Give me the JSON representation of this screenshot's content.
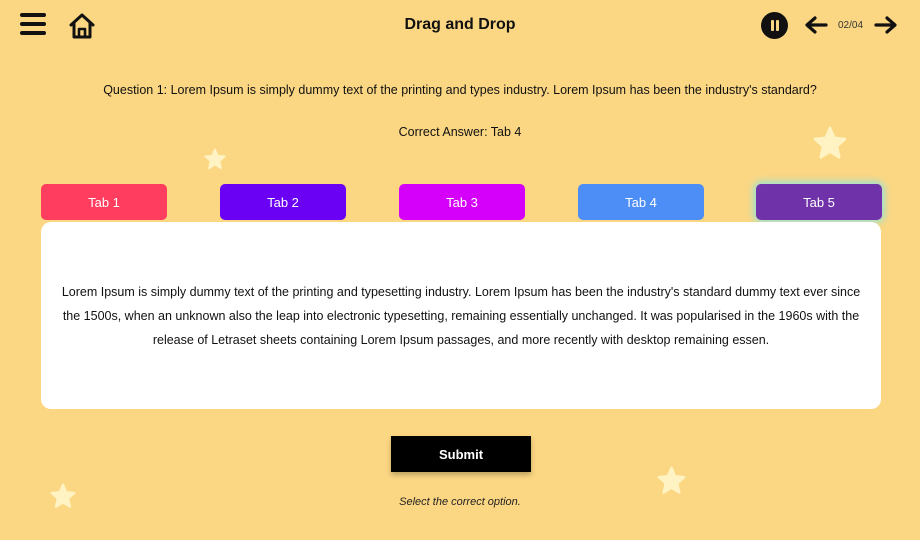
{
  "header": {
    "title": "Drag and Drop",
    "page_counter": "02/04",
    "icons": [
      "menu-icon",
      "home-icon",
      "pause-icon",
      "arrow-left-icon",
      "arrow-right-icon"
    ]
  },
  "question": {
    "text": "Question 1: Lorem Ipsum is simply dummy text of the printing and types industry. Lorem Ipsum has been the industry's standard?",
    "correct_answer": "Correct Answer: Tab 4"
  },
  "tabs": [
    {
      "label": "Tab 1",
      "color": "#FF3D5E"
    },
    {
      "label": "Tab 2",
      "color": "#6A00F4"
    },
    {
      "label": "Tab 3",
      "color": "#D500F9"
    },
    {
      "label": "Tab 4",
      "color": "#4C8DF6"
    },
    {
      "label": "Tab 5",
      "color": "#7032A8",
      "selected": true
    }
  ],
  "panel": {
    "text": "Lorem Ipsum is simply dummy text of the printing and typesetting industry. Lorem Ipsum has been the industry's standard dummy text ever since the 1500s, when an unknown also the leap into electronic typesetting, remaining essentially unchanged. It was popularised in the 1960s with the release of Letraset sheets containing Lorem Ipsum passages, and more recently with desktop remaining essen."
  },
  "submit_label": "Submit",
  "hint": "Select the correct option.",
  "colors": {
    "background": "#FCD783",
    "star": "#FFF3C4",
    "submit": "#000000"
  }
}
